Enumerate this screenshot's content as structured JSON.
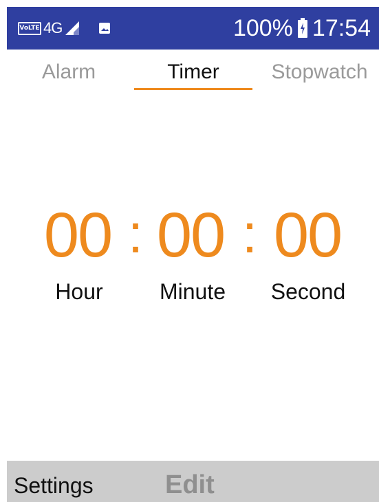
{
  "status_bar": {
    "volte_label": "VoLTE",
    "network": "4G",
    "battery_percent": "100%",
    "time": "17:54",
    "icons": [
      "volte-icon",
      "signal-icon",
      "image-notification-icon",
      "battery-icon"
    ],
    "background_color": "#2f3fa0"
  },
  "tabs": [
    {
      "label": "Alarm",
      "active": false
    },
    {
      "label": "Timer",
      "active": true
    },
    {
      "label": "Stopwatch",
      "active": false
    }
  ],
  "timer": {
    "hours": "00",
    "minutes": "00",
    "seconds": "00",
    "separator": ":",
    "hour_label": "Hour",
    "minute_label": "Minute",
    "second_label": "Second"
  },
  "softkeys": {
    "left": "Settings",
    "center": "Edit"
  },
  "colors": {
    "accent": "#ee8a1e",
    "tab_inactive": "#9a9a9a",
    "softkey_bar": "#cccccc"
  }
}
